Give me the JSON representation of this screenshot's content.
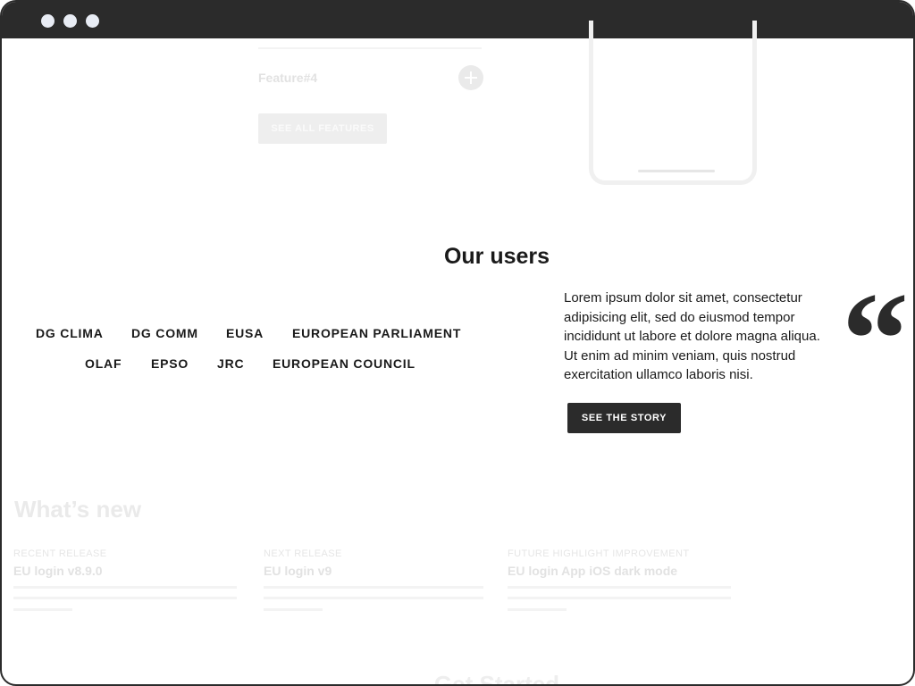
{
  "features": {
    "feature_label": "Feature#4",
    "see_all_label": "SEE ALL FEATURES"
  },
  "users": {
    "title": "Our users",
    "orgs_row1": [
      "DG CLIMA",
      "DG COMM",
      "EUSA",
      "EUROPEAN PARLIAMENT"
    ],
    "orgs_row2": [
      "OLAF",
      "EPSO",
      "JRC",
      "EUROPEAN COUNCIL"
    ],
    "quote": "Lorem ipsum dolor sit amet, consectetur adipisicing elit, sed do eiusmod tempor incididunt ut labore et dolore magna aliqua. Ut enim ad minim veniam, quis nostrud exercitation ullamco laboris nisi.",
    "quote_mark": "“",
    "story_button": "SEE THE STORY"
  },
  "whats_new": {
    "title": "What’s new",
    "items": [
      {
        "label": "RECENT RELEASE",
        "title": "EU login v8.9.0"
      },
      {
        "label": "NEXT RELEASE",
        "title": "EU login v9"
      },
      {
        "label": "FUTURE HIGHLIGHT IMPROVEMENT",
        "title": "EU login App iOS dark mode"
      }
    ]
  },
  "get_started": {
    "title": "Get Started"
  }
}
